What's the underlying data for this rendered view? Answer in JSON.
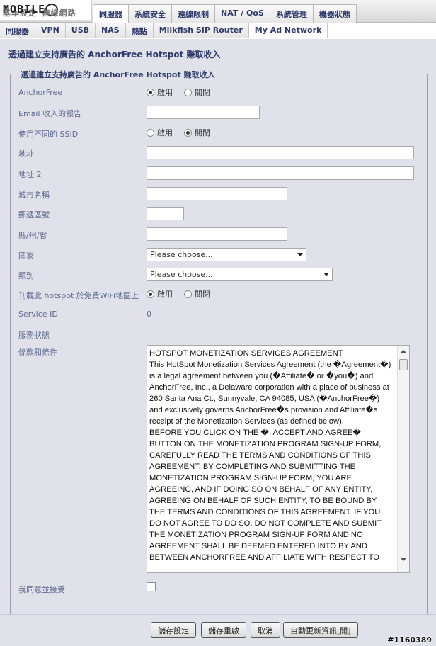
{
  "logo": {
    "text": "MOBILE",
    "behind_text": "基本設定   無線網路"
  },
  "top_tabs": [
    {
      "label": "同服器",
      "active": true
    },
    {
      "label": "系統安全"
    },
    {
      "label": "遠線限制"
    },
    {
      "label": "NAT / QoS"
    },
    {
      "label": "系統管理"
    },
    {
      "label": "機器狀態"
    }
  ],
  "sub_tabs": [
    {
      "label": "同服器"
    },
    {
      "label": "VPN"
    },
    {
      "label": "USB"
    },
    {
      "label": "NAS"
    },
    {
      "label": "熱點"
    },
    {
      "label": "Milkfish SIP Router"
    },
    {
      "label": "My Ad Network",
      "active": true
    }
  ],
  "page_title": "透過建立支持廣告的 AnchorFree Hotspot 賺取收入",
  "section_legend": "透過建立支持廣告的 AnchorFree Hotspot 賺取收入",
  "form": {
    "anchorfree_label": "AnchorFree",
    "enable_label": "啟用",
    "disable_label": "關閉",
    "email_label": "Email 收入的報告",
    "email_value": "",
    "ssid_label": "使用不同的 SSID",
    "address_label": "地址",
    "address_value": "",
    "address2_label": "地址 2",
    "address2_value": "",
    "city_label": "城市名稱",
    "city_value": "",
    "zip_label": "郵遞區號",
    "zip_value": "",
    "state_label": "縣/州/省",
    "state_value": "",
    "country_label": "國家",
    "country_selected": "Please choose...",
    "category_label": "類別",
    "category_selected": "Please choose...",
    "publish_label": "刊載此 hotspot 於免費WiFi地圖上",
    "service_id_label": "Service ID",
    "service_id_value": "0",
    "service_status_label": "服務狀態",
    "terms_label": "條款和條件",
    "terms_text": "HOTSPOT MONETIZATION SERVICES AGREEMENT\nThis HotSpot Monetization Services Agreement (the �Agreement�) is a legal agreement between you (�Affiliate� or �you�) and AnchorFree, Inc., a Delaware corporation with a place of business at 260 Santa Ana Ct., Sunnyvale, CA 94085, USA (�AnchorFree�) and exclusively governs AnchorFree�s provision and Affiliate�s receipt of the Monetization Services (as defined below).\nBEFORE YOU CLICK ON THE �I ACCEPT AND AGREE� BUTTON ON THE MONETIZATION PROGRAM SIGN-UP FORM, CAREFULLY READ THE TERMS AND CONDITIONS OF THIS AGREEMENT. BY COMPLETING AND SUBMITTING THE MONETIZATION PROGRAM SIGN-UP FORM, YOU ARE AGREEING, AND IF DOING SO ON BEHALF OF ANY ENTITY, AGREEING ON BEHALF OF SUCH ENTITY, TO BE BOUND BY THE TERMS AND CONDITIONS OF THIS AGREEMENT. IF YOU DO NOT AGREE TO DO SO, DO NOT COMPLETE AND SUBMIT THE MONETIZATION PROGRAM SIGN-UP FORM AND NO AGREEMENT SHALL BE DEEMED ENTERED INTO BY AND BETWEEN ANCHORFREE AND AFFILIATE WITH RESPECT TO",
    "agree_label": "我同意並接受"
  },
  "buttons": {
    "save": "儲存設定",
    "save_reboot": "儲存重啟",
    "cancel": "取消",
    "auto_refresh": "自動更新資訊[開]"
  },
  "watermark": "#1160389"
}
